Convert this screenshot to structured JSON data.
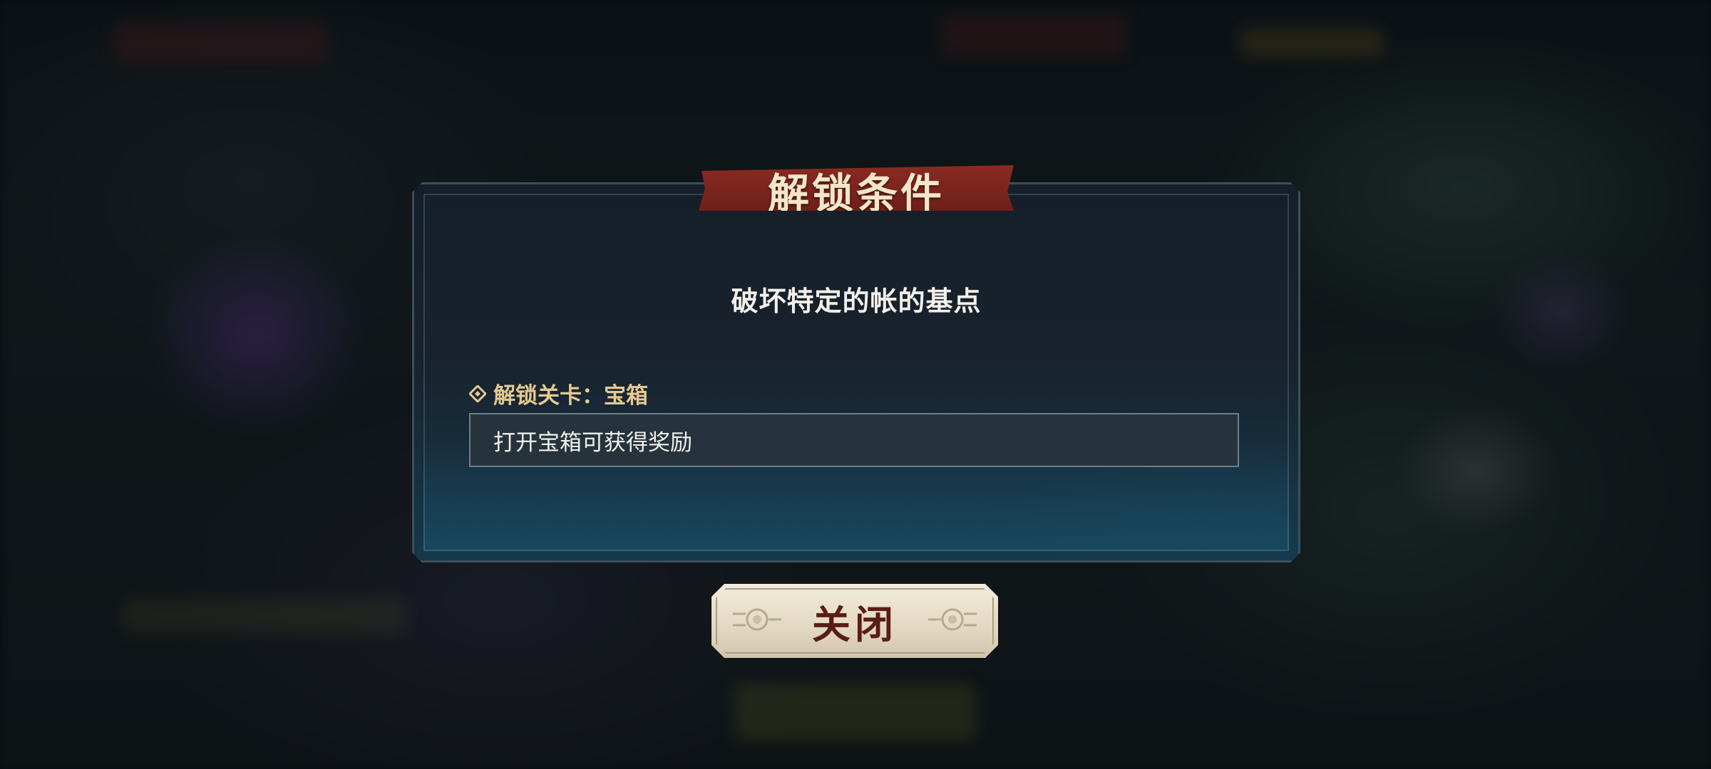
{
  "dialog": {
    "title": "解锁条件",
    "objective": "破坏特定的帐的基点",
    "unlock_label": "解锁关卡：宝箱",
    "description": "打开宝箱可获得奖励"
  },
  "buttons": {
    "close_label": "关闭"
  },
  "colors": {
    "title_banner": "#7a231d",
    "panel_bg": "#18222c",
    "accent_gold": "#e6c98f",
    "button_bg": "#ece3d0",
    "button_text": "#5a1c16"
  },
  "icons": {
    "unlock_label": "diamond-bullet-icon",
    "button_ornament": "circle-ornament-icon"
  }
}
